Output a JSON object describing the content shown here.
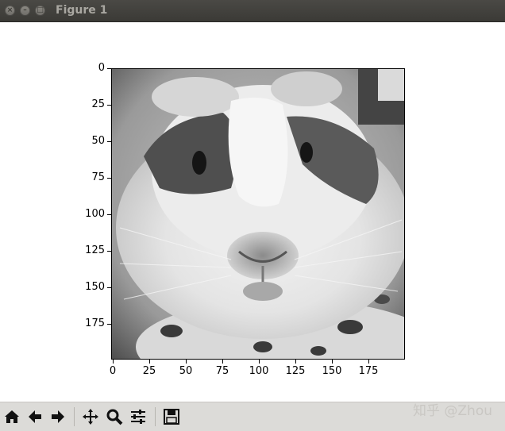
{
  "window": {
    "title": "Figure 1"
  },
  "plot": {
    "y_ticks": [
      "0",
      "25",
      "50",
      "75",
      "100",
      "125",
      "150",
      "175"
    ],
    "x_ticks": [
      "0",
      "25",
      "50",
      "75",
      "100",
      "125",
      "150",
      "175"
    ]
  },
  "toolbar": {
    "icons": [
      "home-icon",
      "back-icon",
      "forward-icon",
      "pan-icon",
      "zoom-icon",
      "configure-subplots-icon",
      "save-icon"
    ]
  },
  "watermark": "知乎 @Zhou"
}
